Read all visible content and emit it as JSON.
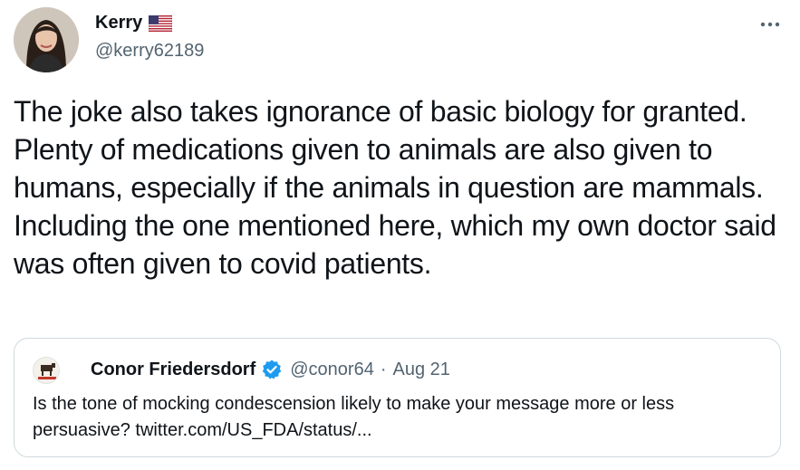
{
  "tweet": {
    "author": {
      "display_name": "Kerry",
      "flag_icon": "us-flag-icon",
      "handle": "@kerry62189"
    },
    "more_icon": "more-horizontal-icon",
    "text": "The joke also takes ignorance of basic biology for granted. Plenty of medications given to animals are also given to humans, especially if the animals in question are mammals. Including the one mentioned here, which my own doctor said was often given to covid patients."
  },
  "quoted_tweet": {
    "author": {
      "display_name": "Conor Friedersdorf",
      "verified_icon": "verified-badge-icon",
      "handle": "@conor64"
    },
    "separator": "·",
    "date": "Aug 21",
    "text": "Is the tone of mocking condescension likely to make your message more or less persuasive? twitter.com/US_FDA/status/..."
  },
  "colors": {
    "text_primary": "#0f1419",
    "text_secondary": "#536471",
    "border": "#cfd9de",
    "verified_blue": "#1d9bf0"
  }
}
